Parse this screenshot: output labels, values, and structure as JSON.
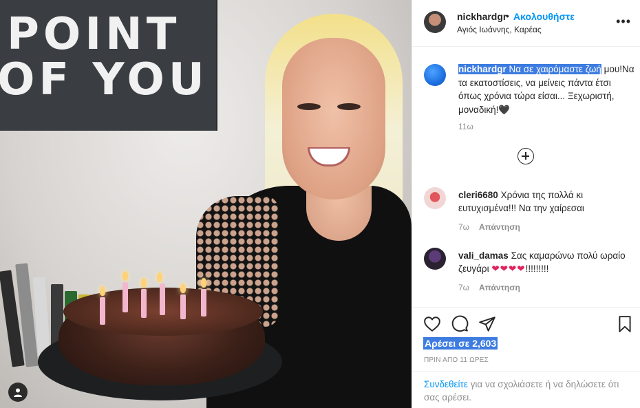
{
  "photo": {
    "sign_line1": "POINT",
    "sign_line2": "OF YOU"
  },
  "header": {
    "username": "nickhardgr",
    "dot": "•",
    "follow_label": "Ακολουθήστε",
    "location": "Αγιός Ιωάννης, Καρέας",
    "more_icon": "more-horizontal-icon"
  },
  "caption": {
    "username": "nickhardgr",
    "text_highlighted": "Να σε χαιρόμαστε ζωή",
    "text_rest": "μου!Να τα εκατοστίσεις, να μείνεις πάντα έτσι όπως χρόνια τώρα είσαι... Ξεχωριστή, μοναδική!🖤",
    "time": "11ω"
  },
  "comments": [
    {
      "username": "cleri6680",
      "text": "Χρόνια της πολλά κι ευτυχισμένα!!! Να την χαίρεσαι",
      "time": "7ω",
      "reply_label": "Απάντηση"
    },
    {
      "username": "vali_damas",
      "text": "Σας καμαρώνω πολύ ωραίο ζευγάρι",
      "hearts": "❤❤❤❤",
      "text_after": "!!!!!!!!!",
      "time": "7ω",
      "reply_label": "Απάντηση"
    }
  ],
  "actions": {
    "likes_label": "Αρέσει σε 2,603",
    "posted_ago": "ΠΡΙΝ ΑΠΟ 11 ΩΡΕΣ"
  },
  "login": {
    "link": "Συνδεθείτε",
    "text": " για να σχολιάσετε ή να δηλώσετε ότι σας αρέσει."
  },
  "colors": {
    "accent": "#0095f6",
    "highlight": "#3d7ce0",
    "muted": "#8e8e8e",
    "heart": "#e0245e"
  }
}
